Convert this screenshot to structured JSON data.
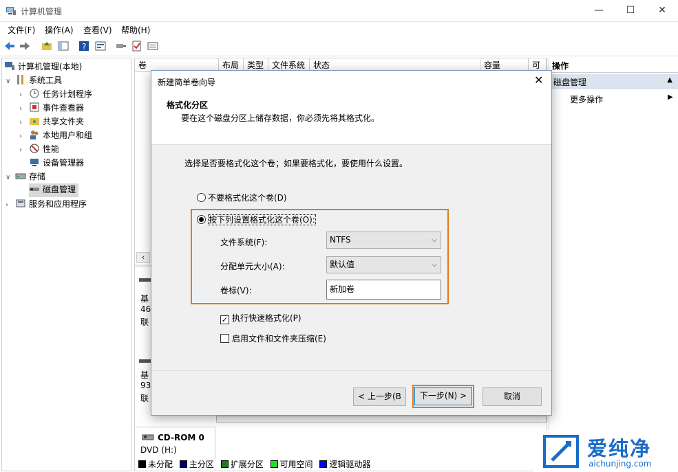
{
  "window": {
    "title": "计算机管理",
    "min": "—",
    "max": "☐",
    "close": "✕"
  },
  "menu": [
    "文件(F)",
    "操作(A)",
    "查看(V)",
    "帮助(H)"
  ],
  "tree": {
    "root": "计算机管理(本地)",
    "system_tools": "系统工具",
    "task_scheduler": "任务计划程序",
    "event_viewer": "事件查看器",
    "shared_folders": "共享文件夹",
    "local_users": "本地用户和组",
    "performance": "性能",
    "device_manager": "设备管理器",
    "storage": "存储",
    "disk_management": "磁盘管理",
    "services": "服务和应用程序"
  },
  "columns": [
    "卷",
    "布局",
    "类型",
    "文件系统",
    "状态",
    "容量",
    "可"
  ],
  "disks": [
    {
      "l1": "基",
      "l2": "46",
      "l3": "联"
    },
    {
      "l1": "基",
      "l2": "93",
      "l3": "联"
    }
  ],
  "cdrom": {
    "name": "CD-ROM 0",
    "drive": "DVD (H:)"
  },
  "legend": [
    {
      "label": "未分配",
      "color": "#000000"
    },
    {
      "label": "主分区",
      "color": "#00006b"
    },
    {
      "label": "扩展分区",
      "color": "#1a7f1a"
    },
    {
      "label": "可用空间",
      "color": "#22dd22"
    },
    {
      "label": "逻辑驱动器",
      "color": "#0000ff"
    }
  ],
  "actions": {
    "header": "操作",
    "section": "磁盘管理",
    "more": "更多操作"
  },
  "dialog": {
    "title": "新建简单卷向导",
    "heading": "格式化分区",
    "subheading": "要在这个磁盘分区上储存数据，你必须先将其格式化。",
    "prompt": "选择是否要格式化这个卷；如果要格式化，要使用什么设置。",
    "no_format": "不要格式化这个卷(D)",
    "format": "按下列设置格式化这个卷(O):",
    "fs_label": "文件系统(F):",
    "fs_value": "NTFS",
    "alloc_label": "分配单元大小(A):",
    "alloc_value": "默认值",
    "vol_label": "卷标(V):",
    "vol_value": "新加卷",
    "quick_format": "执行快速格式化(P)",
    "compress": "启用文件和文件夹压缩(E)",
    "back": "< 上一步(B",
    "next": "下一步(N) >",
    "cancel": "取消",
    "highlight_color": "#e07b1a"
  },
  "watermark": {
    "brand": "爱纯净",
    "url": "aichunjing.com"
  }
}
